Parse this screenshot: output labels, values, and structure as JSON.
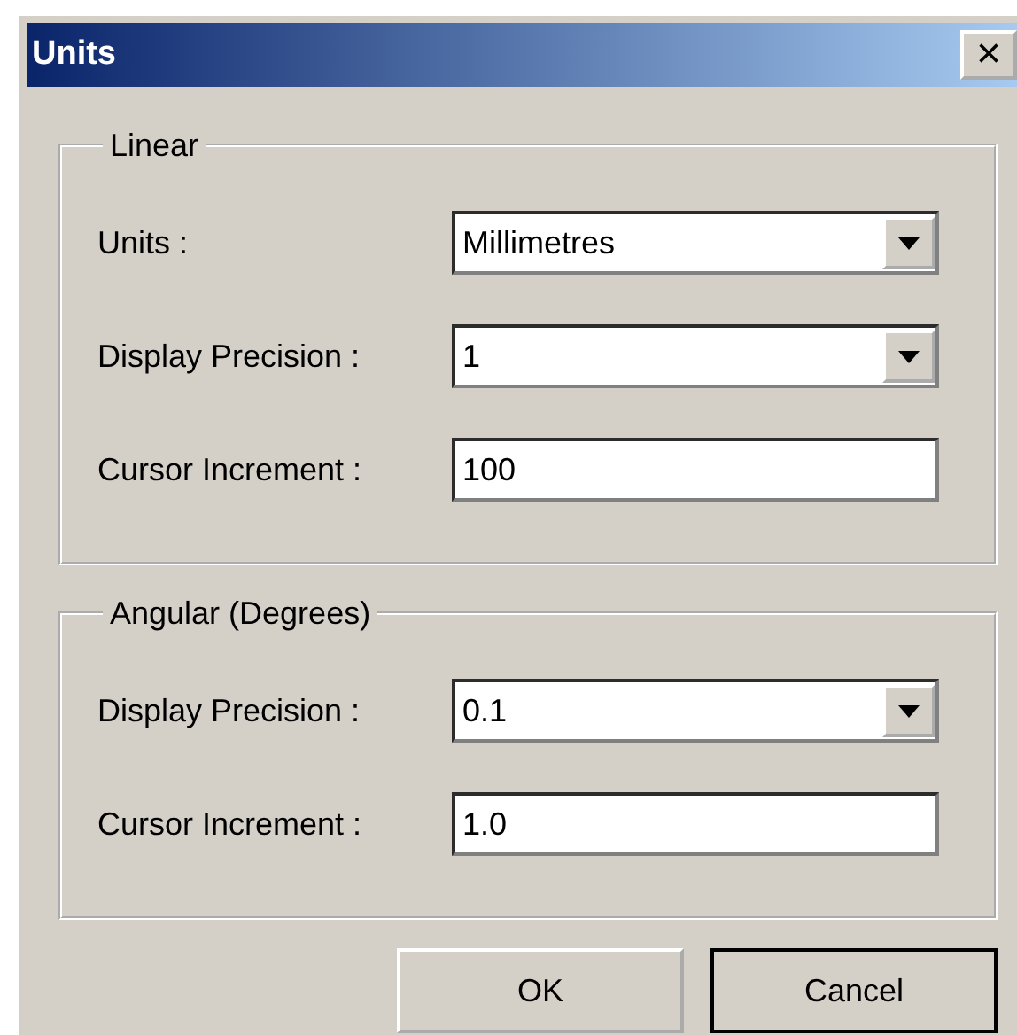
{
  "window": {
    "title": "Units",
    "close_button": "×"
  },
  "groups": [
    {
      "legend": "Linear",
      "rows": [
        {
          "label": "Units :",
          "kind": "dropdown",
          "value": "Millimetres"
        },
        {
          "label": "Display Precision :",
          "kind": "dropdown",
          "value": "1"
        },
        {
          "label": "Cursor Increment :",
          "kind": "text",
          "value": "100"
        }
      ]
    },
    {
      "legend": "Angular (Degrees)",
      "rows": [
        {
          "label": "Display Precision :",
          "kind": "dropdown",
          "value": "0.1"
        },
        {
          "label": "Cursor Increment :",
          "kind": "text",
          "value": "1.0"
        }
      ]
    }
  ],
  "buttons": [
    {
      "label": "OK",
      "default": false
    },
    {
      "label": "Cancel",
      "default": true
    }
  ]
}
